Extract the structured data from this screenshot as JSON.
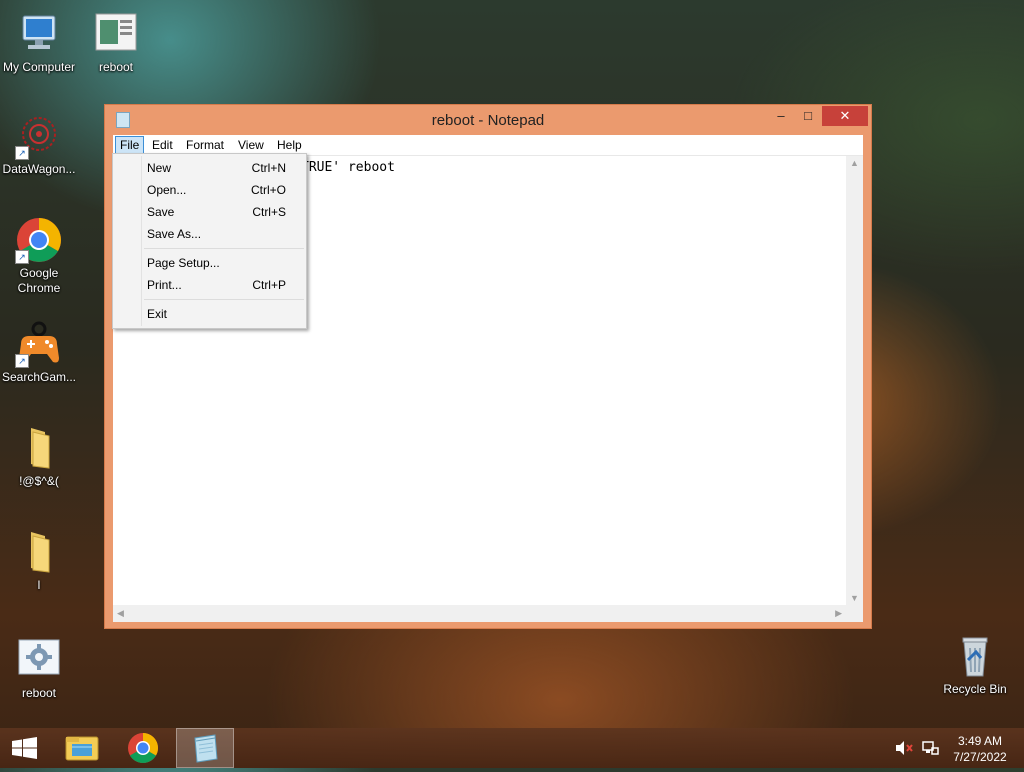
{
  "desktop": {
    "icons": [
      {
        "label": "My Computer"
      },
      {
        "label": "reboot"
      },
      {
        "label": "DataWagon..."
      },
      {
        "label": "Google Chrome"
      },
      {
        "label": "SearchGam..."
      },
      {
        "label": "!@$^&("
      },
      {
        "label": "l"
      },
      {
        "label": "reboot"
      },
      {
        "label": "Recycle Bin"
      }
    ]
  },
  "window": {
    "title": "reboot - Notepad",
    "controls": {
      "minimize": "–",
      "maximize": "□",
      "close": "✕"
    },
    "menu": [
      "File",
      "Edit",
      "Format",
      "View",
      "Help"
    ],
    "active_menu": "File",
    "text_content": "TRUE' reboot"
  },
  "file_menu": {
    "items": [
      {
        "label": "New",
        "shortcut": "Ctrl+N"
      },
      {
        "label": "Open...",
        "shortcut": "Ctrl+O"
      },
      {
        "label": "Save",
        "shortcut": "Ctrl+S"
      },
      {
        "label": "Save As...",
        "shortcut": ""
      },
      {
        "label": "Page Setup...",
        "shortcut": ""
      },
      {
        "label": "Print...",
        "shortcut": "Ctrl+P"
      },
      {
        "label": "Exit",
        "shortcut": ""
      }
    ]
  },
  "taskbar": {
    "time": "3:49 AM",
    "date": "7/27/2022"
  },
  "colors": {
    "window_frame": "#eb9a6e",
    "close_button": "#c7413a",
    "menu_highlight": "#cce4f7"
  }
}
